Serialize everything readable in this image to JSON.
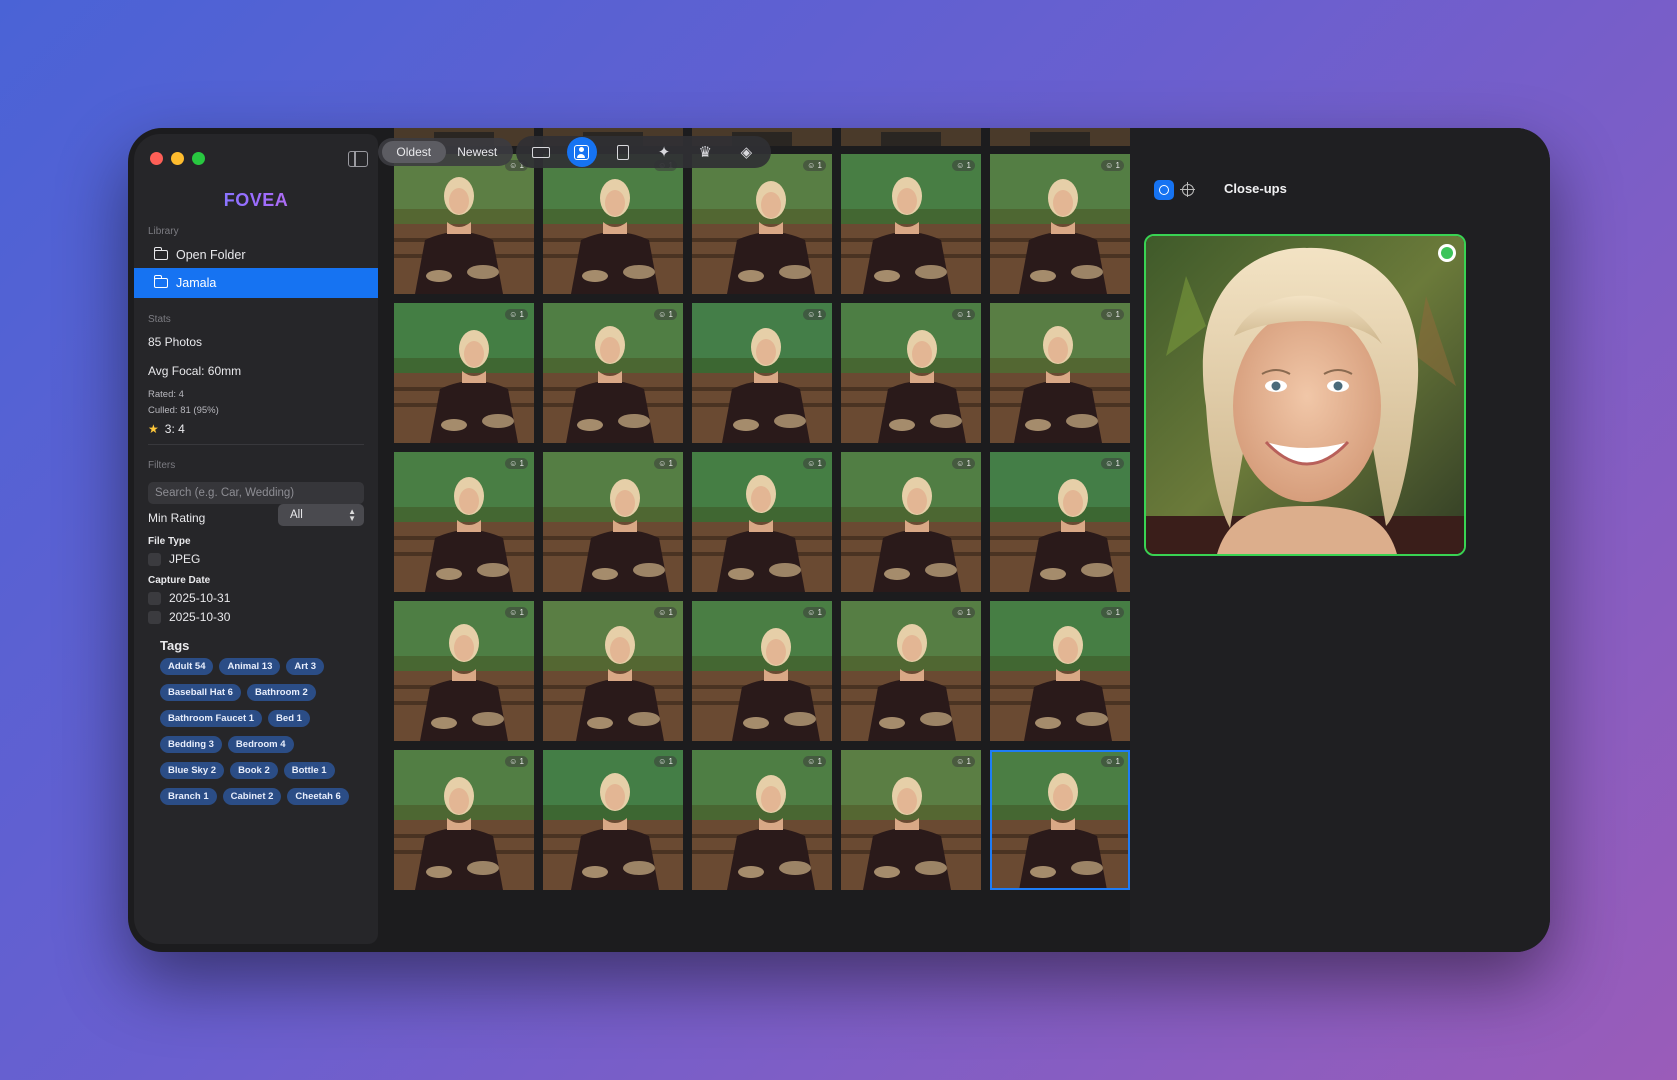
{
  "window": {
    "app_name": "FOVEA",
    "traffic_lights": [
      "close",
      "minimize",
      "zoom"
    ]
  },
  "sidebar": {
    "library_label": "Library",
    "items": [
      {
        "label": "Open Folder",
        "icon": "folder-plus-icon",
        "active": false
      },
      {
        "label": "Jamala",
        "icon": "folder-icon",
        "active": true
      }
    ],
    "stats_label": "Stats",
    "stats": {
      "photos": "85 Photos",
      "avg_focal": "Avg Focal: 60mm",
      "rated": "Rated: 4",
      "culled": "Culled: 81 (95%)",
      "star_rating": "3: 4"
    },
    "filters_label": "Filters",
    "search_placeholder": "Search (e.g. Car, Wedding)",
    "min_rating_label": "Min Rating",
    "min_rating_value": "All",
    "file_type_label": "File Type",
    "file_types": [
      "JPEG"
    ],
    "capture_date_label": "Capture Date",
    "capture_dates": [
      "2025-10-31",
      "2025-10-30"
    ],
    "tags_title": "Tags",
    "tags": [
      "Adult 54",
      "Animal 13",
      "Art 3",
      "Baseball Hat 6",
      "Bathroom 2",
      "Bathroom Faucet 1",
      "Bed 1",
      "Bedding 3",
      "Bedroom 4",
      "Blue Sky 2",
      "Book 2",
      "Bottle 1",
      "Branch 1",
      "Cabinet 2",
      "Cheetah 6"
    ]
  },
  "toolbar": {
    "sort_options": [
      "Oldest",
      "Newest"
    ],
    "sort_selected": "Oldest",
    "tools": [
      {
        "name": "keyboard-icon",
        "active": false
      },
      {
        "name": "person-icon",
        "active": true
      },
      {
        "name": "clipboard-icon",
        "active": false
      },
      {
        "name": "sparkle-icon",
        "active": false
      },
      {
        "name": "crown-icon",
        "active": false
      },
      {
        "name": "layers-icon",
        "active": false
      }
    ]
  },
  "grid": {
    "columns": 5,
    "rows": 5,
    "badge_text": "1",
    "selected_index": 24
  },
  "panel": {
    "title": "Close-ups",
    "modes": [
      "face-icon",
      "crosshair-icon"
    ],
    "active_mode": "face-icon",
    "accent_color": "#39d353"
  },
  "colors": {
    "accent": "#1673f2",
    "tag_bg": "#2b4d86",
    "close": "#fe5f57",
    "minimize": "#febc2e",
    "zoom": "#28c840"
  }
}
